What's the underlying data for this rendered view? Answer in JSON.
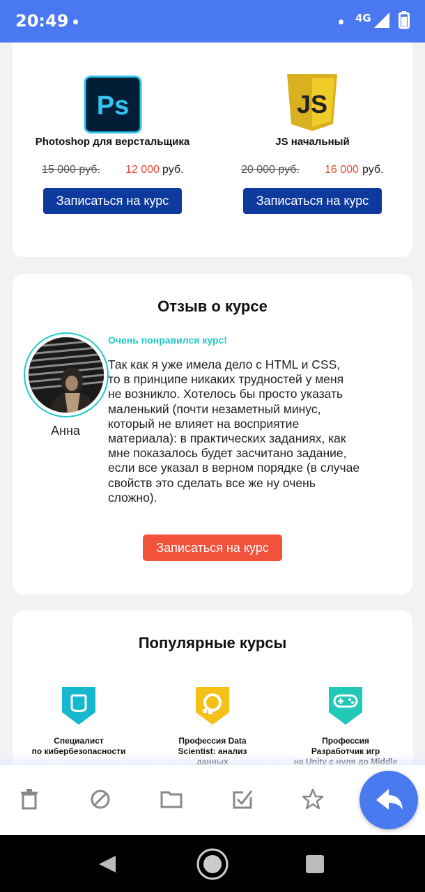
{
  "status_bar": {
    "time": "20:49",
    "network": "4G"
  },
  "courses": [
    {
      "title": "Photoshop для верстальщика",
      "old_price": "15 000 руб.",
      "new_price": "12 000",
      "currency": "руб.",
      "button": "Записаться на курс",
      "logo_text": "Ps"
    },
    {
      "title": "JS начальный",
      "old_price": "20 000 руб.",
      "new_price": "16 000",
      "currency": "руб.",
      "button": "Записаться на курс",
      "logo_text": "JS"
    }
  ],
  "review": {
    "title": "Отзыв о курсе",
    "heading": "Очень понравился курс!",
    "author": "Анна",
    "text": "Так как я уже имела дело с HTML и CSS,\nто в принципе никаких трудностей у меня\nне возникло. Хотелось бы просто указать\nмаленький (почти незаметный минус,\nкоторый не влияет на восприятие\nматериала): в практических заданиях, как\nмне показалось будет засчитано задание,\nесли все указал в верном порядке (в случае\nсвойств это сделать все же ну очень\nсложно).",
    "button": "Записаться на курс"
  },
  "popular": {
    "title": "Популярные курсы",
    "items": [
      {
        "label": "Специалист\nпо кибербезопасности",
        "icon": "shield-icon",
        "color": "#16b8d0"
      },
      {
        "label": "Профессия Data\nScientist: анализ\nданных",
        "icon": "data-science-icon",
        "color": "#f5c018"
      },
      {
        "label": "Профессия\nРазработчик игр\nна Unity с нуля до Middle",
        "icon": "gamepad-icon",
        "color": "#22c9b8"
      }
    ]
  },
  "toolbar": {
    "icons": [
      "delete-icon",
      "block-icon",
      "folder-icon",
      "mark-done-icon",
      "star-icon",
      "reply-icon"
    ]
  },
  "colors": {
    "accent": "#4a78f0",
    "primary_button": "#0e3a9e",
    "cta_button": "#f2513a",
    "price_new": "#ef4a3a",
    "teal": "#1fc9c9"
  }
}
